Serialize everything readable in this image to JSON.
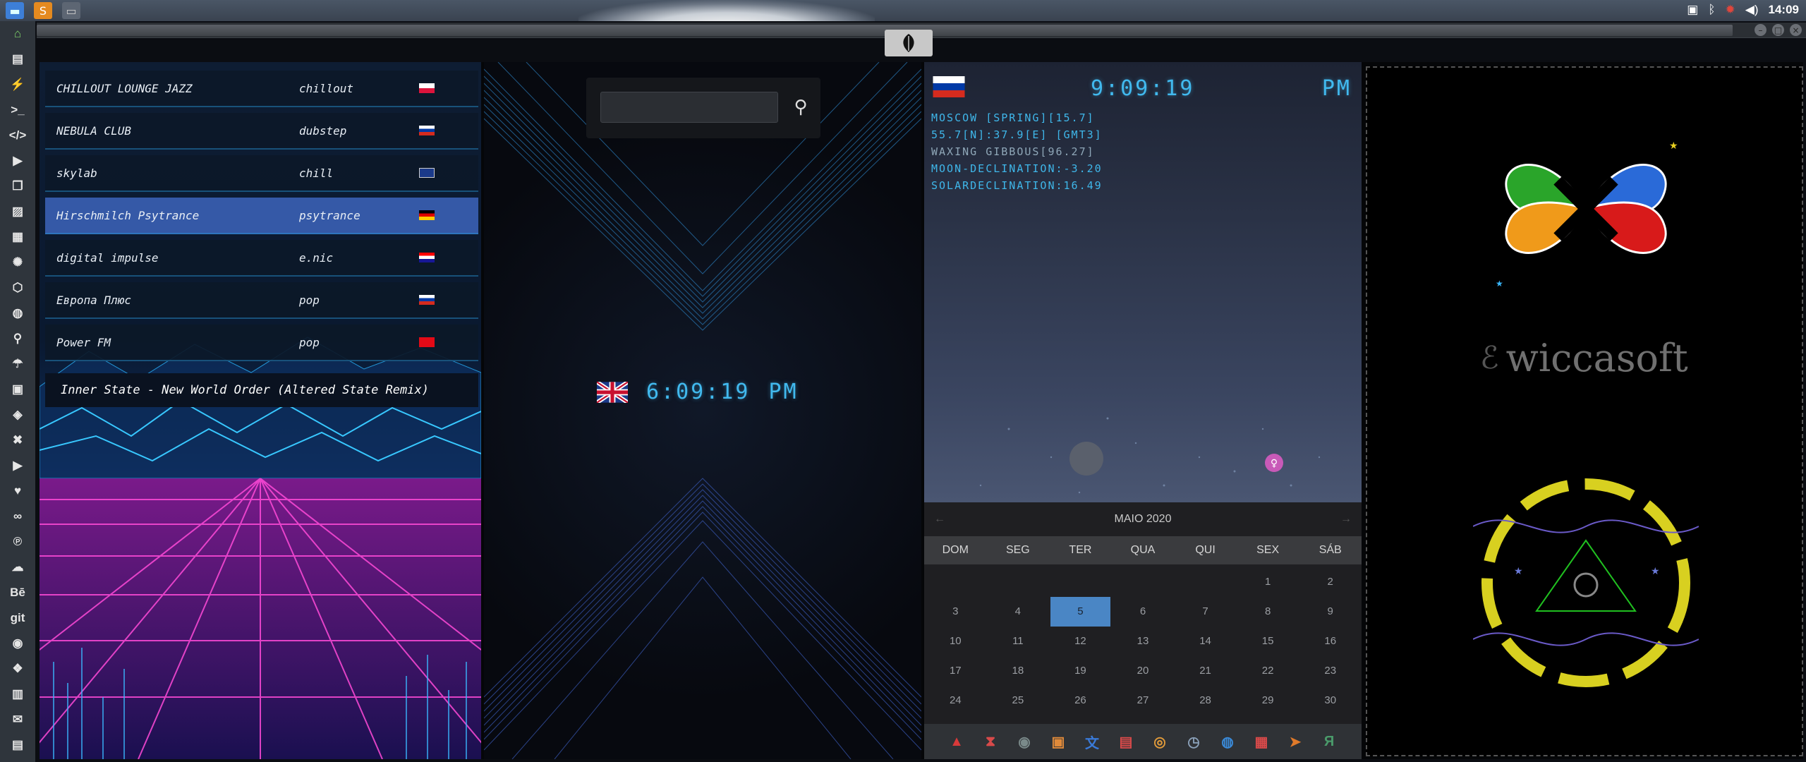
{
  "topbar": {
    "clock": "14:09",
    "tray_icons": [
      "image-icon",
      "bluetooth-icon",
      "virus-icon",
      "volume-icon"
    ]
  },
  "dock": {
    "items": [
      "home",
      "document",
      "flash",
      ">_",
      "</>",
      "play",
      "copy",
      "image",
      "news",
      "cog",
      "hex",
      "globe",
      "search",
      "umbrella",
      "contact",
      "tag",
      "tools",
      "youtube",
      "heart",
      "infinity",
      "pinterest",
      "cloud",
      "Bē",
      "git",
      "github",
      "layers",
      "map",
      "mail",
      "server"
    ]
  },
  "radio": {
    "stations": [
      {
        "name": "CHILLOUT LOUNGE JAZZ",
        "genre": "chillout",
        "flag": "poland"
      },
      {
        "name": "NEBULA CLUB",
        "genre": "dubstep",
        "flag": "russia"
      },
      {
        "name": "skylab",
        "genre": "chill",
        "flag": "uk"
      },
      {
        "name": "Hirschmilch Psytrance",
        "genre": "psytrance",
        "flag": "germany"
      },
      {
        "name": "digital impulse",
        "genre": "e.nic",
        "flag": "croatia"
      },
      {
        "name": "Европа Плюс",
        "genre": "pop",
        "flag": "russia"
      },
      {
        "name": "Power FM",
        "genre": "pop",
        "flag": "turkey"
      }
    ],
    "selected_index": 3,
    "now_playing": "Inner State - New World Order (Altered State Remix)"
  },
  "middle": {
    "search_placeholder": "",
    "time": "6:09:19",
    "ampm": "PM"
  },
  "world": {
    "time": "9:09:19",
    "ampm": "PM",
    "lines": [
      "MOSCOW [SPRING][15.7]",
      "55.7[N]:37.9[E] [GMT3]",
      "WAXING GIBBOUS[96.27]",
      "MOON-DECLINATION:-3.20",
      "SOLARDECLINATION:16.49"
    ]
  },
  "calendar": {
    "month": "MAIO 2020",
    "weekdays": [
      "DOM",
      "SEG",
      "TER",
      "QUA",
      "QUI",
      "SEX",
      "SÁB"
    ],
    "rows": [
      [
        "",
        "",
        "",
        "",
        "",
        "1",
        "2"
      ],
      [
        "3",
        "4",
        "5",
        "6",
        "7",
        "8",
        "9"
      ],
      [
        "10",
        "11",
        "12",
        "13",
        "14",
        "15",
        "16"
      ],
      [
        "17",
        "18",
        "19",
        "20",
        "21",
        "22",
        "23"
      ],
      [
        "24",
        "25",
        "26",
        "27",
        "28",
        "29",
        "30"
      ]
    ],
    "today": "5"
  },
  "taskbar": {
    "apps": [
      {
        "icon": "arch-icon",
        "glyph": "▲",
        "color": "#d83a3a"
      },
      {
        "icon": "hourglass-icon",
        "glyph": "⧗",
        "color": "#d84a4a"
      },
      {
        "icon": "mask-icon",
        "glyph": "◉",
        "color": "#7a8a8a"
      },
      {
        "icon": "photo-icon",
        "glyph": "▣",
        "color": "#e08a3a"
      },
      {
        "icon": "translate-icon",
        "glyph": "文",
        "color": "#3a7ad8"
      },
      {
        "icon": "browser-icon",
        "glyph": "▤",
        "color": "#d84a4a"
      },
      {
        "icon": "search-app-icon",
        "glyph": "◎",
        "color": "#e09a3a"
      },
      {
        "icon": "clock-app-icon",
        "glyph": "◷",
        "color": "#8aa0b8"
      },
      {
        "icon": "web-icon",
        "glyph": "◍",
        "color": "#3a8ad8"
      },
      {
        "icon": "calendar-app-icon",
        "glyph": "▦",
        "color": "#d84a4a"
      },
      {
        "icon": "arrow-app-icon",
        "glyph": "➤",
        "color": "#e07a2a"
      },
      {
        "icon": "yandex-icon",
        "glyph": "Я",
        "color": "#4a9a6a"
      }
    ]
  },
  "wicca": {
    "brand": "wiccasoft"
  },
  "colors": {
    "digital": "#41b9ee",
    "selected_row": "#3559a7",
    "today": "#4a86c5"
  }
}
